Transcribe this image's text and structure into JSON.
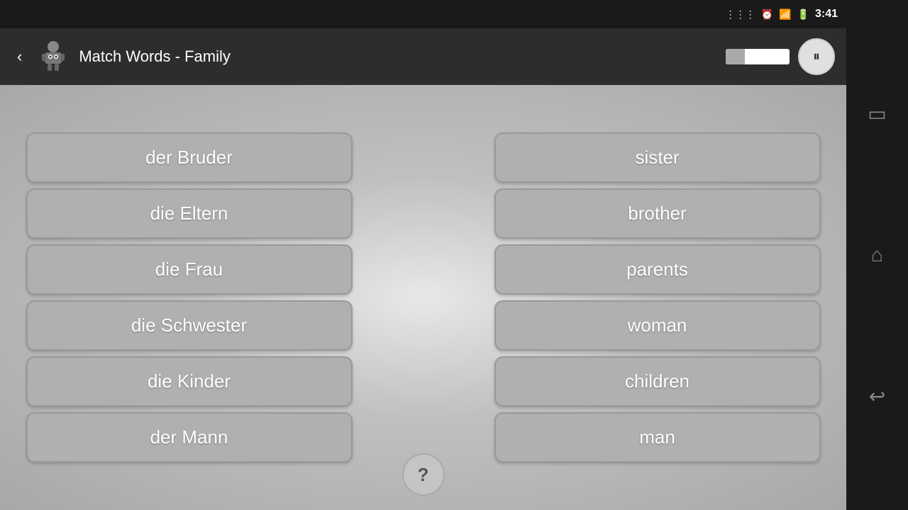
{
  "statusBar": {
    "time": "3:41"
  },
  "titleBar": {
    "title": "Match Words - Family",
    "backLabel": "‹",
    "pauseLabel": "⏸",
    "progressPercent": 30
  },
  "leftColumn": {
    "cards": [
      {
        "id": "bruder",
        "text": "der Bruder"
      },
      {
        "id": "eltern",
        "text": "die Eltern"
      },
      {
        "id": "frau",
        "text": "die Frau"
      },
      {
        "id": "schwester",
        "text": "die Schwester"
      },
      {
        "id": "kinder",
        "text": "die Kinder"
      },
      {
        "id": "mann",
        "text": "der Mann"
      }
    ]
  },
  "rightColumn": {
    "cards": [
      {
        "id": "sister",
        "text": "sister"
      },
      {
        "id": "brother",
        "text": "brother"
      },
      {
        "id": "parents",
        "text": "parents"
      },
      {
        "id": "woman",
        "text": "woman"
      },
      {
        "id": "children",
        "text": "children"
      },
      {
        "id": "man",
        "text": "man"
      }
    ]
  },
  "helpButton": {
    "label": "?"
  },
  "navBar": {
    "icons": [
      "▭",
      "⌂",
      "↩"
    ]
  }
}
